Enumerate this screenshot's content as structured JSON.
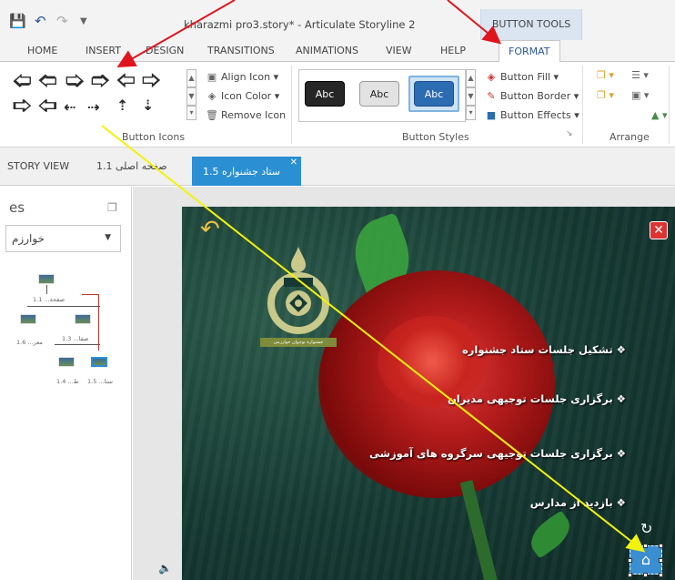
{
  "app": {
    "title": "kharazmi pro3.story* - Articulate Storyline 2"
  },
  "ribbon": {
    "contextual_group": "BUTTON TOOLS",
    "tabs": [
      "HOME",
      "INSERT",
      "DESIGN",
      "TRANSITIONS",
      "ANIMATIONS",
      "VIEW",
      "HELP",
      "FORMAT"
    ],
    "active_tab": "FORMAT",
    "button_icons": {
      "label": "Button Icons",
      "icons": [
        "arrow-left",
        "arrow-right",
        "arrow-up",
        "arrow-down",
        "arrow-up-left",
        "arrow-up-right",
        "arrow-down-left",
        "arrow-down-right",
        "arrow-left-dotted",
        "arrow-right-dotted",
        "arrow-up-dotted",
        "arrow-down-dotted"
      ],
      "commands": [
        "Align Icon",
        "Icon Color",
        "Remove Icon"
      ]
    },
    "button_styles": {
      "label": "Button Styles",
      "samples": [
        "Abc",
        "Abc",
        "Abc"
      ],
      "commands": [
        "Button Fill",
        "Button Border",
        "Button Effects"
      ]
    },
    "arrange": {
      "label": "Arrange"
    }
  },
  "slide_tabs": {
    "story_view": "STORY VIEW",
    "tab_1": "صفحه اصلی 1.1",
    "active": "ستاد جشنواره 1.5"
  },
  "scenes_panel": {
    "title": "es",
    "scene_select": "خوارزم",
    "nodes": [
      {
        "caption": "1.1 ...صفحة"
      },
      {
        "caption": "1.6 ...معر"
      },
      {
        "caption": "1.3 ...صفا"
      },
      {
        "caption": "1.4 ...ط"
      },
      {
        "caption": "1.5 ...ستا"
      }
    ]
  },
  "slide": {
    "logo_text": "جشنواره نوجوان خوارزمی",
    "bullets": [
      "❖ تشکیل جلسات ستاد جشنواره",
      "❖ برگزاری جلسات توجیهی مدیران",
      "❖ برگزاری جلسات توجیهی سرگروه های آموزشی",
      "❖ بازدید از مدارس"
    ]
  },
  "colors": {
    "accent": "#2b579a",
    "active_tab_blue": "#2b8fd3",
    "annotation_red": "#e0141e",
    "annotation_yellow": "#f2f20a"
  }
}
